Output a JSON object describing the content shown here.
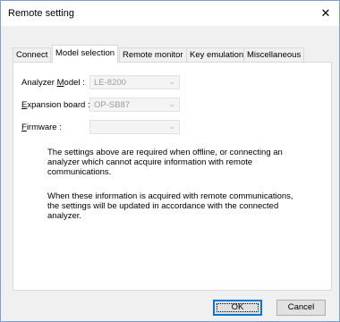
{
  "window": {
    "title": "Remote setting",
    "close_glyph": "✕"
  },
  "tabs": [
    {
      "label": "Connect",
      "active": false
    },
    {
      "label": "Model selection",
      "active": true
    },
    {
      "label": "Remote monitor",
      "active": false
    },
    {
      "label": "Key emulation",
      "active": false
    },
    {
      "label": "Miscellaneous",
      "active": false
    }
  ],
  "fields": {
    "model": {
      "label_pre": "Analyzer ",
      "label_key": "M",
      "label_post": "odel :",
      "value": "LE-8200"
    },
    "board": {
      "label_pre": "",
      "label_key": "E",
      "label_post": "xpansion board :",
      "value": "OP-SB87"
    },
    "firmware": {
      "label_pre": "",
      "label_key": "F",
      "label_post": "irmware :",
      "value": ""
    }
  },
  "notes": {
    "offline": "The settings above are required when offline, or connecting an analyzer which cannot acquire information with remote communications.",
    "update": "When these information is acquired with remote communications, the settings will be updated in accordance with the connected analyzer."
  },
  "buttons": {
    "ok": "OK",
    "cancel": "Cancel"
  },
  "icons": {
    "combo_arrow": "⌄"
  }
}
